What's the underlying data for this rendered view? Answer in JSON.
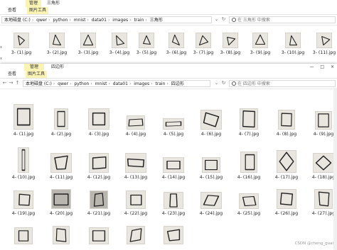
{
  "w1": {
    "tool_tab": "管理",
    "title": "三角形",
    "tabs": [
      "查看",
      "图片工具"
    ],
    "path": [
      "本地磁盘 (C:)",
      "qwer",
      "python",
      "mnist",
      "data01",
      "images",
      "train",
      "三角形"
    ],
    "search": "在 三角形 中搜索",
    "side_chars": [
      "x",
      "x"
    ],
    "labels": [
      "3- (1).jpg",
      "3- (2).jpg",
      "3- (3).jpg",
      "3- (4).jpg",
      "3- (5).jpg",
      "3- (6).jpg",
      "3- (7).jpg",
      "3- (8).jpg",
      "3- (9).jpg",
      "3- (10).jpg",
      "3- (11).jpg"
    ]
  },
  "w2": {
    "tool_tab": "管理",
    "title": "四边形",
    "tabs": [
      "查看",
      "图片工具"
    ],
    "path": [
      "本地磁盘 (C:)",
      "qwer",
      "python",
      "mnist",
      "data01",
      "images",
      "train",
      "四边形"
    ],
    "search": "在 四边形 中搜索",
    "win_buttons": [
      "—",
      "□",
      "×"
    ],
    "labels": [
      "4- (1).jpg",
      "4- (2).jpg",
      "4- (3).jpg",
      "4- (4).jpg",
      "4- (5).jpg",
      "4- (6).jpg",
      "4- (7).jpg",
      "4- (8).jpg",
      "4- (9).jpg",
      "4- (10).jpg",
      "4- (11).jpg",
      "4- (12).jpg",
      "4- (13).jpg",
      "4- (14).jpg",
      "4- (15).jpg",
      "4- (16).jpg",
      "4- (17).jpg",
      "4- (18).jpg",
      "4- (19).jpg",
      "4- (20).jpg",
      "4- (21).jpg",
      "4- (22).jpg",
      "4- (23).jpg",
      "4- (24).jpg",
      "4- (25).jpg",
      "4- (26).jpg",
      "4- (27).jpg",
      "",
      "",
      "",
      "",
      "",
      "",
      "",
      "",
      ""
    ]
  },
  "watermark": "CSDN @cheng_guai",
  "colors": {
    "tool_tab": "#fbf3b4",
    "active_tab": "#2b579a",
    "thumb_bg": "#e9e6df"
  }
}
